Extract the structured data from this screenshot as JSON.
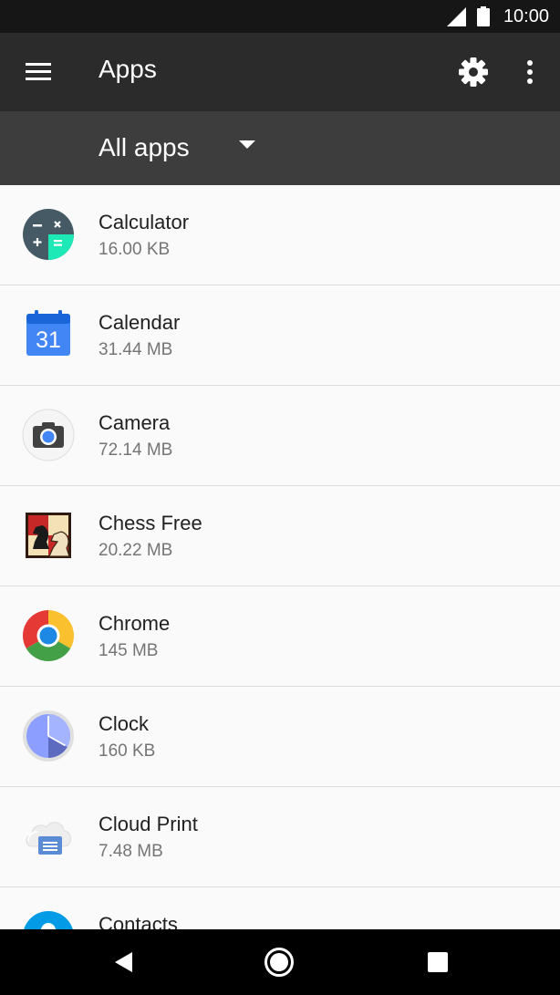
{
  "status_bar": {
    "time": "10:00",
    "icons": [
      "signal-icon",
      "battery-icon"
    ]
  },
  "app_bar": {
    "title": "Apps",
    "icons": [
      "menu-icon",
      "gear-icon",
      "more-vert-icon"
    ]
  },
  "filter": {
    "label": "All apps",
    "icon": "arrow-drop-down-icon"
  },
  "apps": [
    {
      "name": "Calculator",
      "size": "16.00 KB",
      "icon": "calculator-icon"
    },
    {
      "name": "Calendar",
      "size": "31.44 MB",
      "icon": "calendar-icon",
      "icon_text": "31"
    },
    {
      "name": "Camera",
      "size": "72.14 MB",
      "icon": "camera-icon"
    },
    {
      "name": "Chess Free",
      "size": "20.22 MB",
      "icon": "chess-icon"
    },
    {
      "name": "Chrome",
      "size": "145 MB",
      "icon": "chrome-icon"
    },
    {
      "name": "Clock",
      "size": "160 KB",
      "icon": "clock-icon"
    },
    {
      "name": "Cloud Print",
      "size": "7.48 MB",
      "icon": "cloud-print-icon"
    },
    {
      "name": "Contacts",
      "size": "",
      "icon": "contacts-icon"
    }
  ],
  "nav_bar": {
    "icons": [
      "back-icon",
      "home-icon",
      "recents-icon"
    ]
  },
  "colors": {
    "status_bar": "#161616",
    "app_bar": "#2b2b2b",
    "filter_bar": "#3d3d3d",
    "list_background": "#fafafa",
    "divider": "#dcdcdc",
    "primary_text": "#212121",
    "secondary_text": "#757575"
  }
}
